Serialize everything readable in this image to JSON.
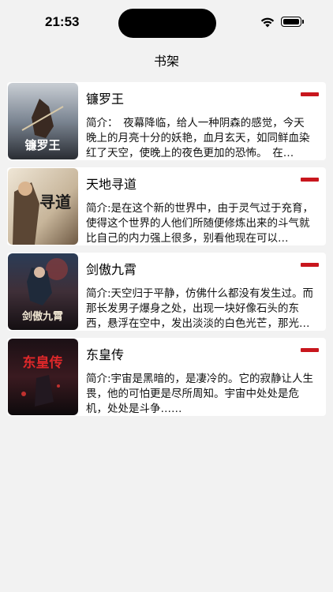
{
  "status_bar": {
    "time": "21:53"
  },
  "nav": {
    "title": "书架"
  },
  "books": [
    {
      "title": "镰罗王",
      "description": "简介：　夜幕降临，给人一种阴森的感觉，今天晚上的月亮十分的妖艳，血月玄天，如同鲜血染红了天空，使晚上的夜色更加的恐怖。　在…",
      "cover_text": "镰罗王"
    },
    {
      "title": "天地寻道",
      "description": "简介:是在这个新的世界中，由于灵气过于充育，使得这个世界的人他们所随便修炼出来的斗气就比自己的内力强上很多，别看他现在可以…",
      "cover_text": "寻道"
    },
    {
      "title": "剑傲九霄",
      "description": "简介:天空归于平静，仿佛什么都没有发生过。而那长发男子爆身之处，出现一块好像石头的东西，悬浮在空中，发出淡淡的白色光芒，那光…",
      "cover_text": "剑傲九霄"
    },
    {
      "title": "东皇传",
      "description": "简介:宇宙是黑暗的，是凄冷的。它的寂静让人生畏，他的可怕更是尽所周知。宇宙中处处是危机，处处是斗争……",
      "cover_text": "东皇传"
    }
  ]
}
